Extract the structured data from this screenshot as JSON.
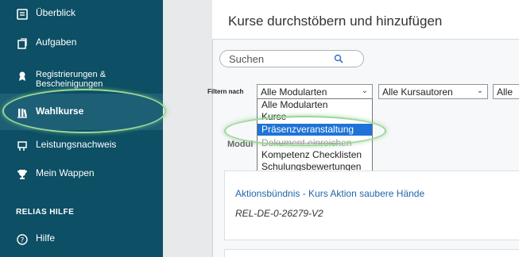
{
  "sidebar": {
    "items": [
      {
        "label": "Überblick",
        "icon": "dashboard-icon"
      },
      {
        "label": "Aufgaben",
        "icon": "tasks-icon"
      },
      {
        "label": "Registrierungen & Bescheinigungen",
        "icon": "registration-icon"
      },
      {
        "label": "Wahlkurse",
        "icon": "library-icon",
        "active": true
      },
      {
        "label": "Leistungsnachweis",
        "icon": "certificate-icon"
      },
      {
        "label": "Mein Wappen",
        "icon": "trophy-icon"
      }
    ],
    "section_label": "RELIAS HILFE",
    "help_label": "Hilfe"
  },
  "main": {
    "title": "Kurse durchstöbern und hinzufügen",
    "search_placeholder": "Suchen",
    "filter_label": "Filtern nach",
    "filters": {
      "module_type": "Alle Modularten",
      "authors": "Alle Kursautoren",
      "third": "Alle"
    },
    "dropdown_options": [
      "Alle Modularten",
      "Kurse",
      "Präsenzveranstaltung",
      "Dokument einreichen",
      "Kompetenz Checklisten",
      "Schulungsbewertungen"
    ],
    "selected_option": "Präsenzveranstaltung",
    "modul_label": "Modul",
    "course": {
      "title": "Aktionsbündnis - Kurs Aktion saubere Hände",
      "code": "REL-DE-0-26279-V2"
    }
  },
  "colors": {
    "sidebar": "#0d4f64",
    "highlight": "#9bd69b",
    "selection": "#1e73d6",
    "link": "#2266aa"
  }
}
